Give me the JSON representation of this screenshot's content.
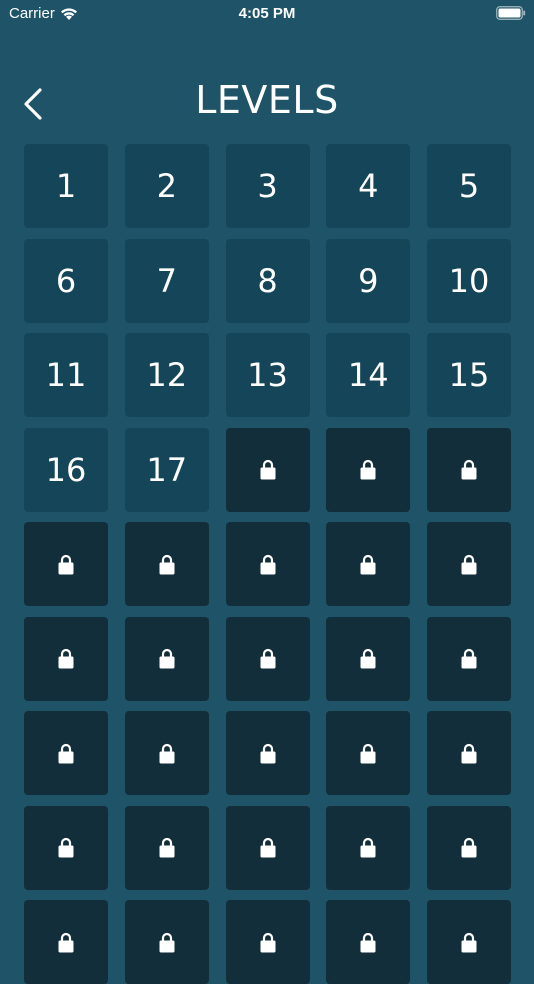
{
  "status_bar": {
    "carrier": "Carrier",
    "time": "4:05 PM"
  },
  "header": {
    "title": "LEVELS"
  },
  "levels": [
    {
      "number": "1",
      "locked": false
    },
    {
      "number": "2",
      "locked": false
    },
    {
      "number": "3",
      "locked": false
    },
    {
      "number": "4",
      "locked": false
    },
    {
      "number": "5",
      "locked": false
    },
    {
      "number": "6",
      "locked": false
    },
    {
      "number": "7",
      "locked": false
    },
    {
      "number": "8",
      "locked": false
    },
    {
      "number": "9",
      "locked": false
    },
    {
      "number": "10",
      "locked": false
    },
    {
      "number": "11",
      "locked": false
    },
    {
      "number": "12",
      "locked": false
    },
    {
      "number": "13",
      "locked": false
    },
    {
      "number": "14",
      "locked": false
    },
    {
      "number": "15",
      "locked": false
    },
    {
      "number": "16",
      "locked": false
    },
    {
      "number": "17",
      "locked": false
    },
    {
      "number": "",
      "locked": true
    },
    {
      "number": "",
      "locked": true
    },
    {
      "number": "",
      "locked": true
    },
    {
      "number": "",
      "locked": true
    },
    {
      "number": "",
      "locked": true
    },
    {
      "number": "",
      "locked": true
    },
    {
      "number": "",
      "locked": true
    },
    {
      "number": "",
      "locked": true
    },
    {
      "number": "",
      "locked": true
    },
    {
      "number": "",
      "locked": true
    },
    {
      "number": "",
      "locked": true
    },
    {
      "number": "",
      "locked": true
    },
    {
      "number": "",
      "locked": true
    },
    {
      "number": "",
      "locked": true
    },
    {
      "number": "",
      "locked": true
    },
    {
      "number": "",
      "locked": true
    },
    {
      "number": "",
      "locked": true
    },
    {
      "number": "",
      "locked": true
    },
    {
      "number": "",
      "locked": true
    },
    {
      "number": "",
      "locked": true
    },
    {
      "number": "",
      "locked": true
    },
    {
      "number": "",
      "locked": true
    },
    {
      "number": "",
      "locked": true
    },
    {
      "number": "",
      "locked": true
    },
    {
      "number": "",
      "locked": true
    },
    {
      "number": "",
      "locked": true
    },
    {
      "number": "",
      "locked": true
    },
    {
      "number": "",
      "locked": true
    }
  ],
  "colors": {
    "background": "#1f5468",
    "unlocked_tile": "#154558",
    "locked_tile": "#122e3a",
    "text": "#ffffff"
  },
  "icons": {
    "back": "chevron-left-icon",
    "lock": "lock-icon",
    "wifi": "wifi-icon",
    "battery": "battery-icon"
  }
}
